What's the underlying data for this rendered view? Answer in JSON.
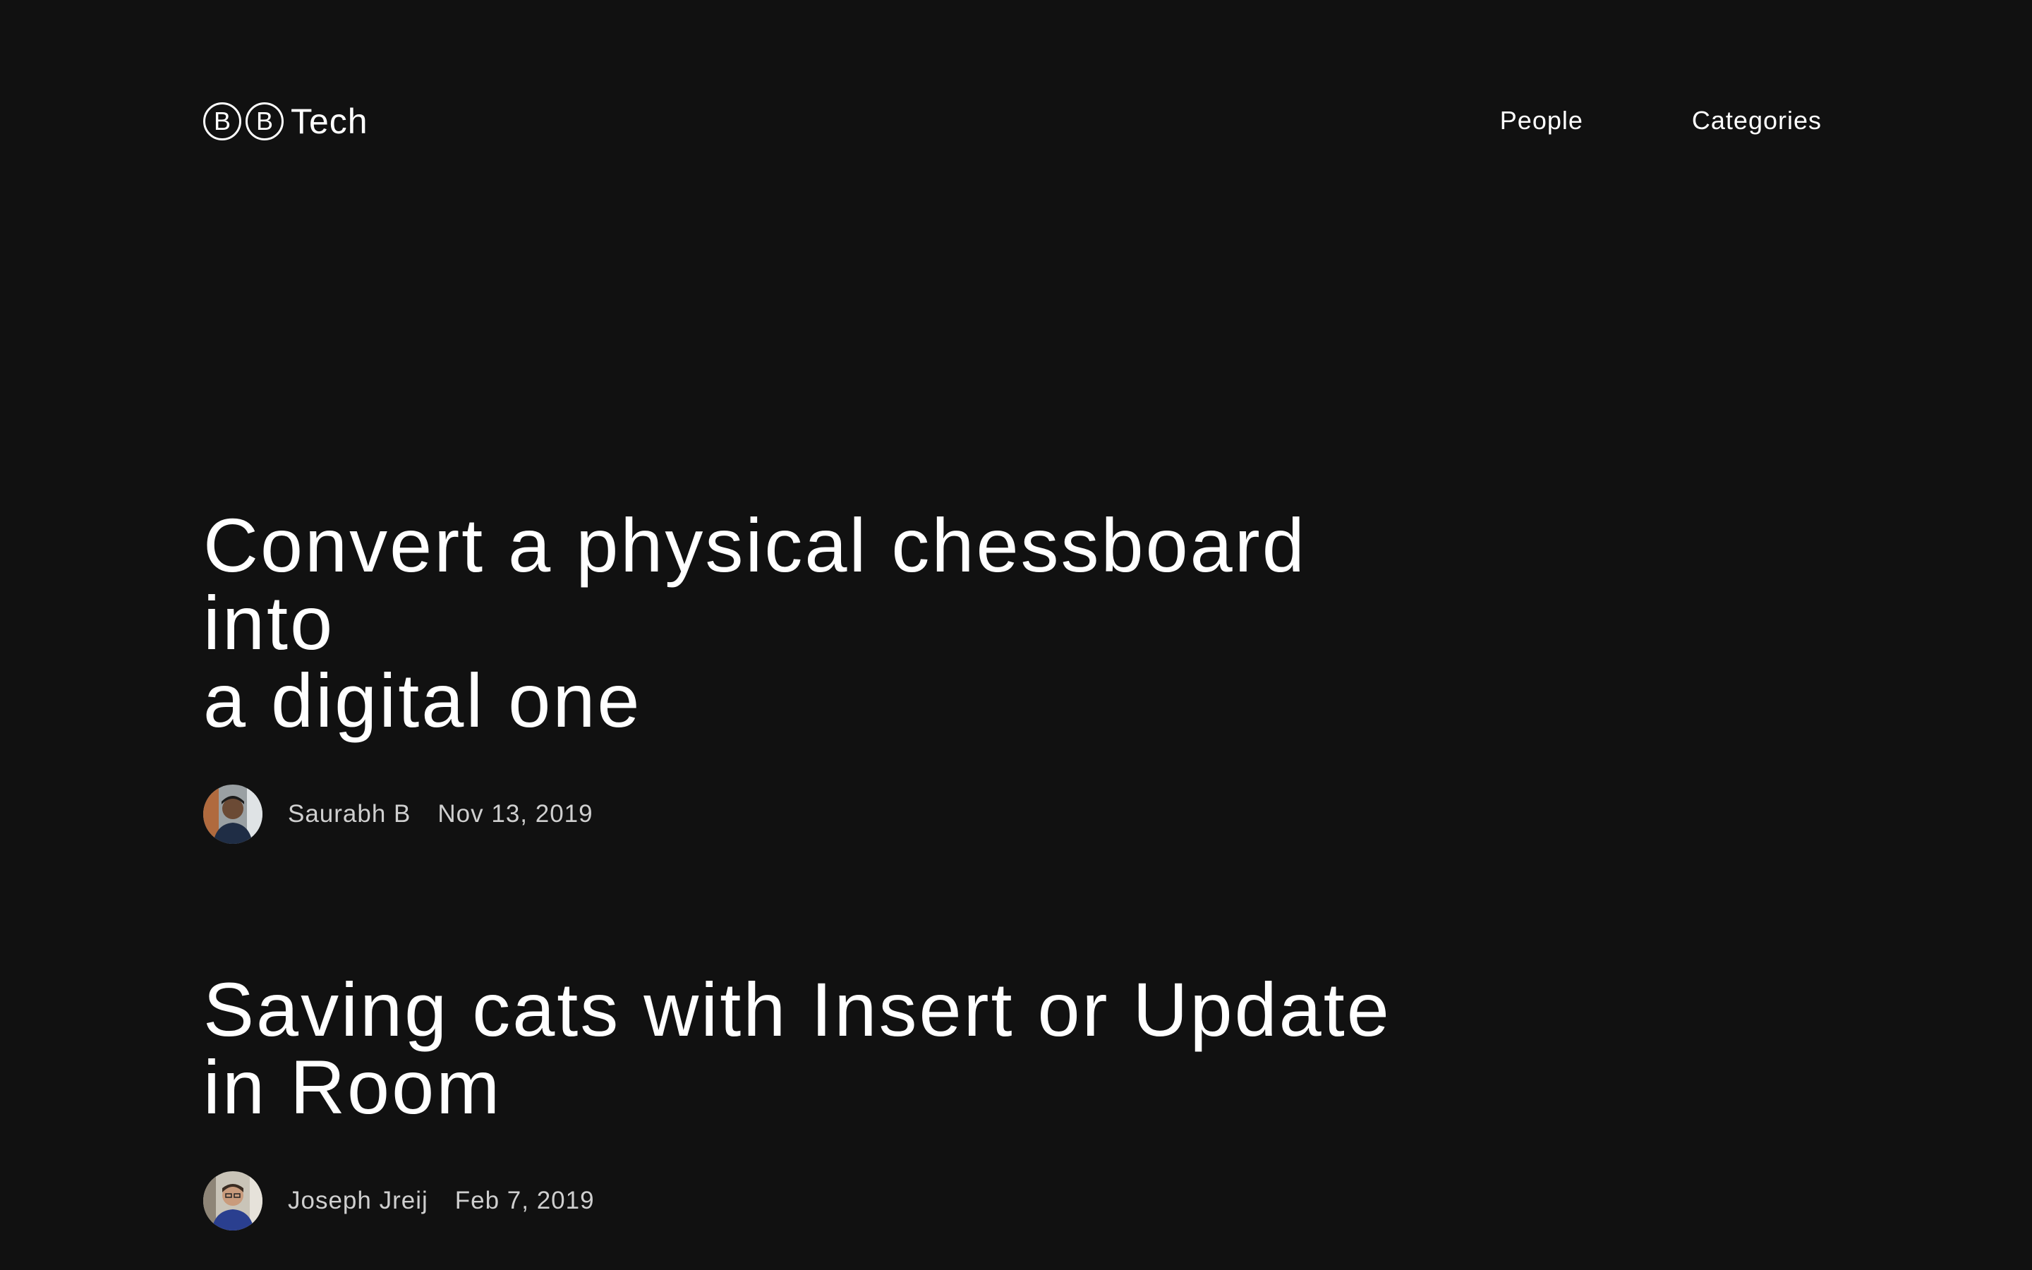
{
  "brand": {
    "circle_letters": [
      "B",
      "B"
    ],
    "name": "Tech"
  },
  "nav": {
    "items": [
      {
        "label": "People"
      },
      {
        "label": "Categories"
      }
    ]
  },
  "posts": [
    {
      "title_line1": "Convert a physical chessboard into",
      "title_line2": "a digital one",
      "author": "Saurabh B",
      "date": "Nov 13, 2019",
      "avatar_icon": "author-photo-icon"
    },
    {
      "title_line1": "Saving cats with Insert or Update",
      "title_line2": "in Room",
      "author": "Joseph Jreij",
      "date": "Feb 7, 2019",
      "avatar_icon": "author-photo-icon"
    }
  ],
  "colors": {
    "background": "#111111",
    "text": "#ffffff",
    "meta_text": "#cfcfcf"
  }
}
